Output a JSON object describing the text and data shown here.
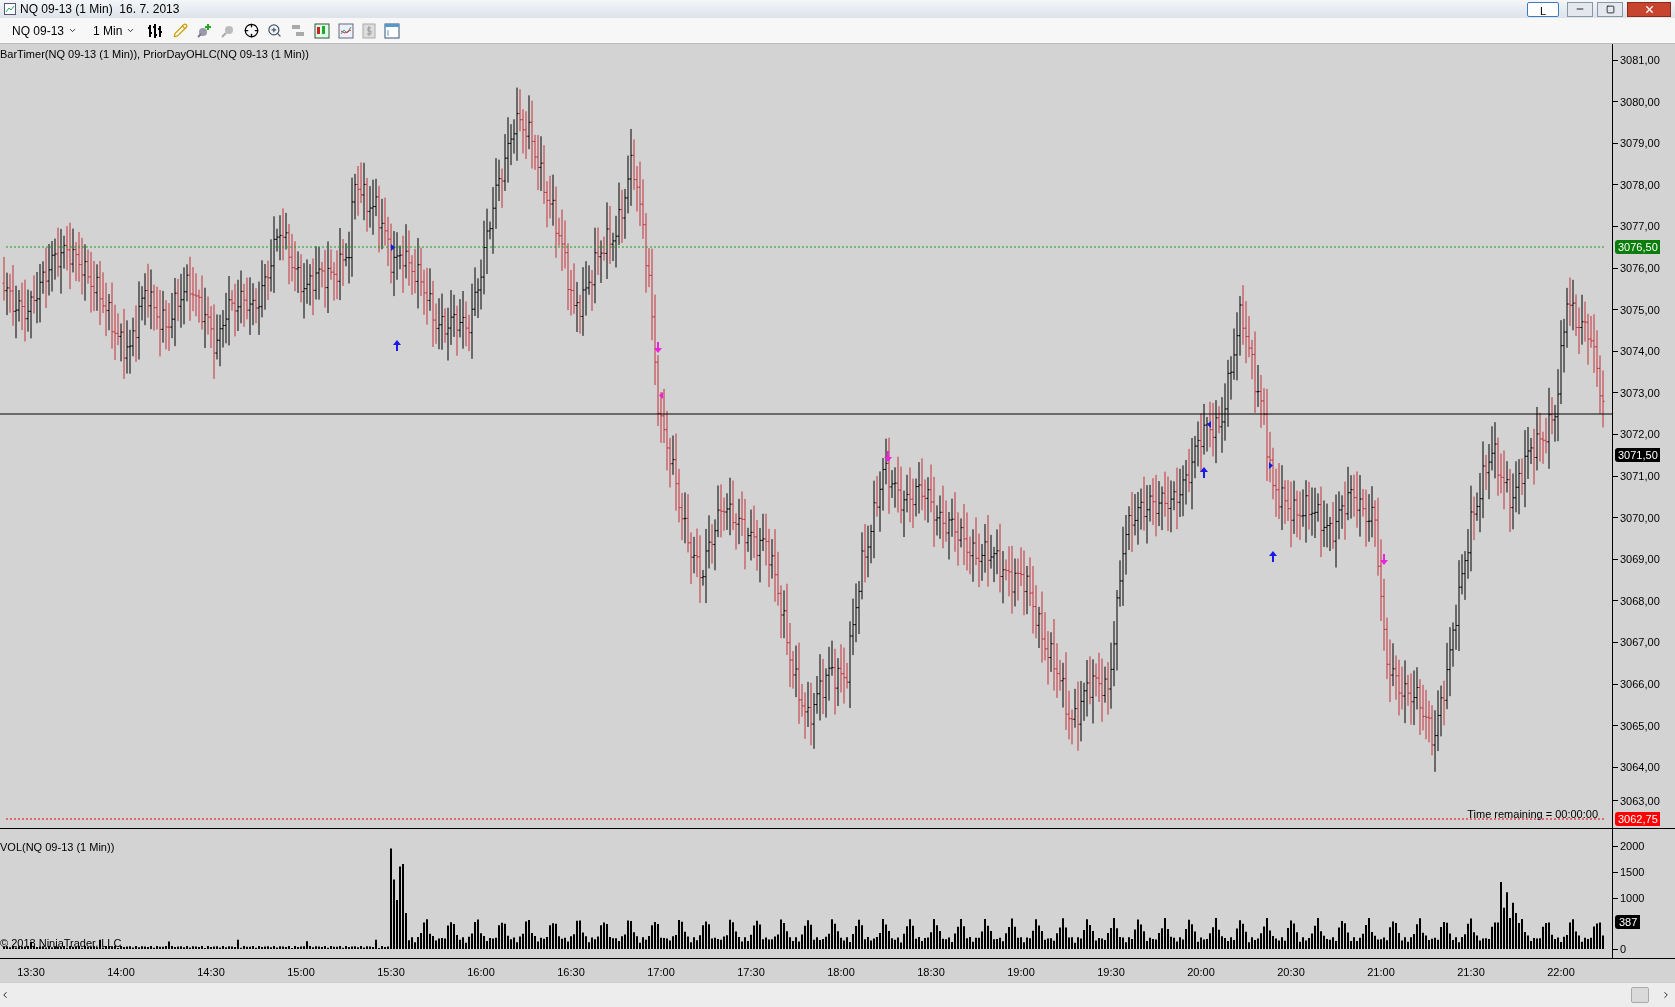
{
  "window": {
    "title": "NQ 09-13 (1 Min)  16. 7. 2013",
    "buttons": [
      "L"
    ]
  },
  "toolbar": {
    "instrument": "NQ 09-13",
    "interval": "1 Min"
  },
  "price_panel": {
    "label": "BarTimer(NQ 09-13 (1 Min)), PriorDayOHLC(NQ 09-13 (1 Min))",
    "timer": "Time remaining = 00:00:00",
    "axis_labels": [
      "3081,00",
      "3080,00",
      "3079,00",
      "3078,00",
      "3077,00",
      "3076,00",
      "3075,00",
      "3074,00",
      "3073,00",
      "3072,00",
      "3071,00",
      "3070,00",
      "3069,00",
      "3068,00",
      "3067,00",
      "3066,00",
      "3065,00",
      "3064,00",
      "3063,00"
    ],
    "markers": [
      {
        "text": "3076,50",
        "color": "#0b7d0b"
      },
      {
        "text": "3071,50",
        "color": "#000000"
      },
      {
        "text": "3062,75",
        "color": "#ff0000"
      }
    ]
  },
  "volume_panel": {
    "label": "VOL(NQ 09-13 (1 Min))",
    "copyright": "© 2013 NinjaTrader, LLC",
    "axis_labels": [
      "2000",
      "1500",
      "1000",
      "0"
    ],
    "markers": [
      {
        "text": "387",
        "color": "#000000"
      }
    ]
  },
  "time_axis": [
    "13:30",
    "14:00",
    "14:30",
    "15:00",
    "15:30",
    "16:00",
    "16:30",
    "17:00",
    "17:30",
    "18:00",
    "18:30",
    "19:00",
    "19:30",
    "20:00",
    "20:30",
    "21:00",
    "21:30",
    "22:00"
  ]
}
